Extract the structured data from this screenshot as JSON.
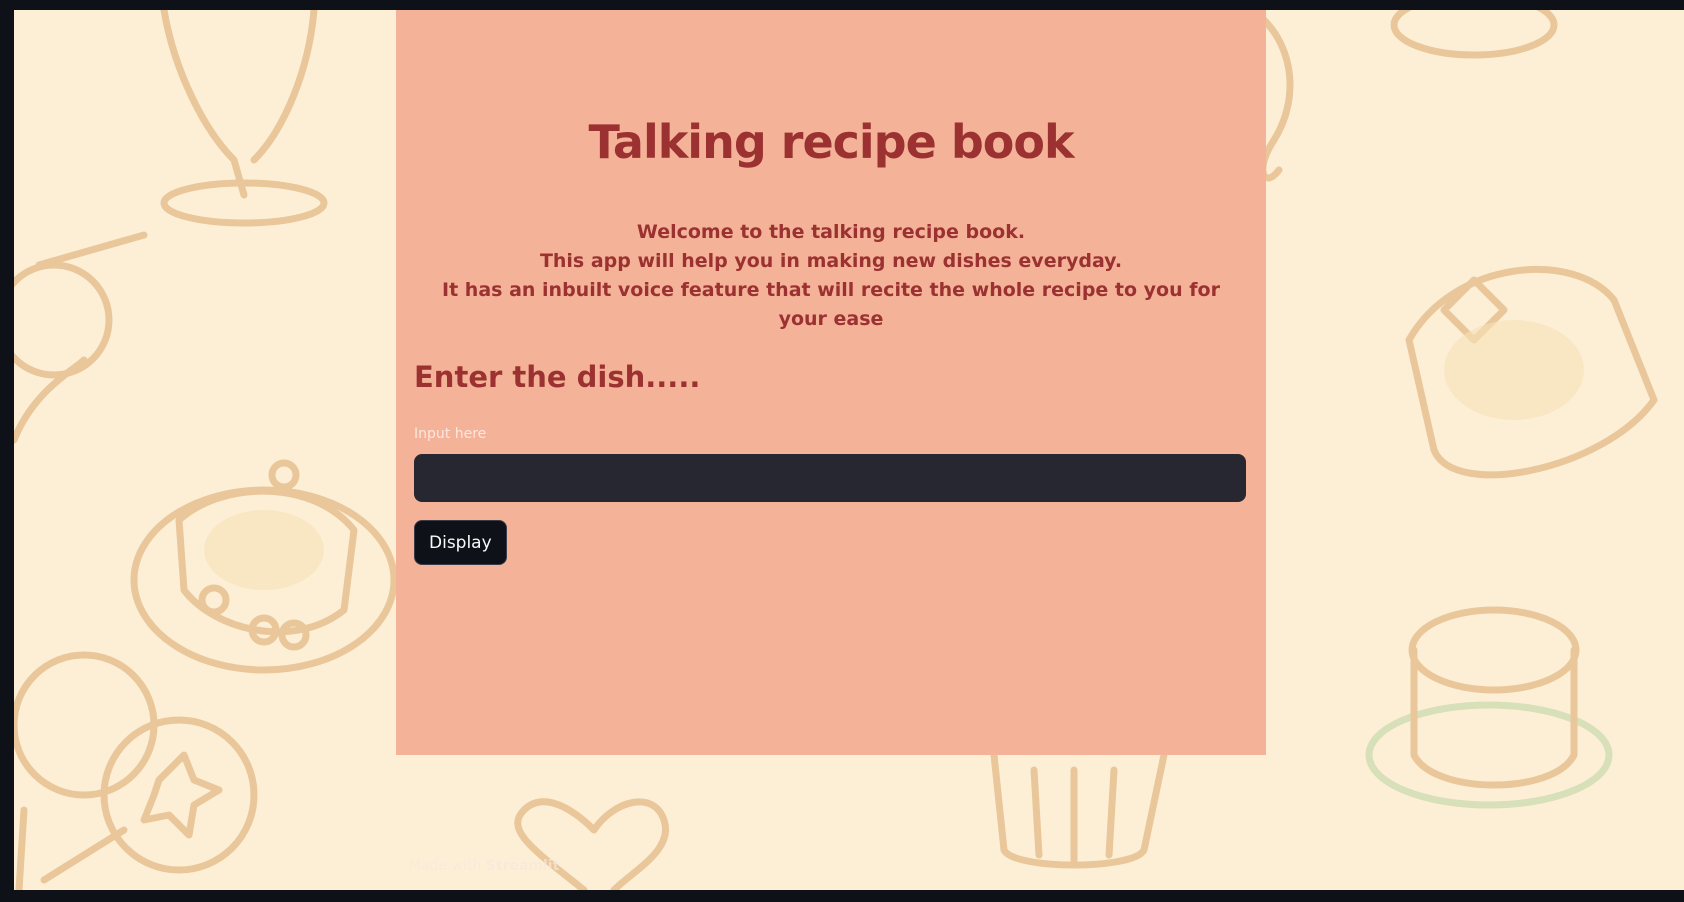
{
  "app": {
    "title": "Talking recipe book",
    "welcome_lines": [
      "Welcome to the talking recipe book.",
      "This app will help you in making new dishes everyday.",
      "It has an inbuilt voice feature that will recite the whole recipe to you for your ease"
    ]
  },
  "form": {
    "heading": "Enter the dish.....",
    "input_label": "Input here",
    "input_value": "",
    "button_label": "Display"
  },
  "footer": {
    "prefix": "Made with",
    "brand": "Streamlit"
  },
  "colors": {
    "page_background": "#fdefd6",
    "panel_background": "#f4b398",
    "heading_color": "#9b3131",
    "input_background": "#262730",
    "button_background": "#0e1117"
  }
}
